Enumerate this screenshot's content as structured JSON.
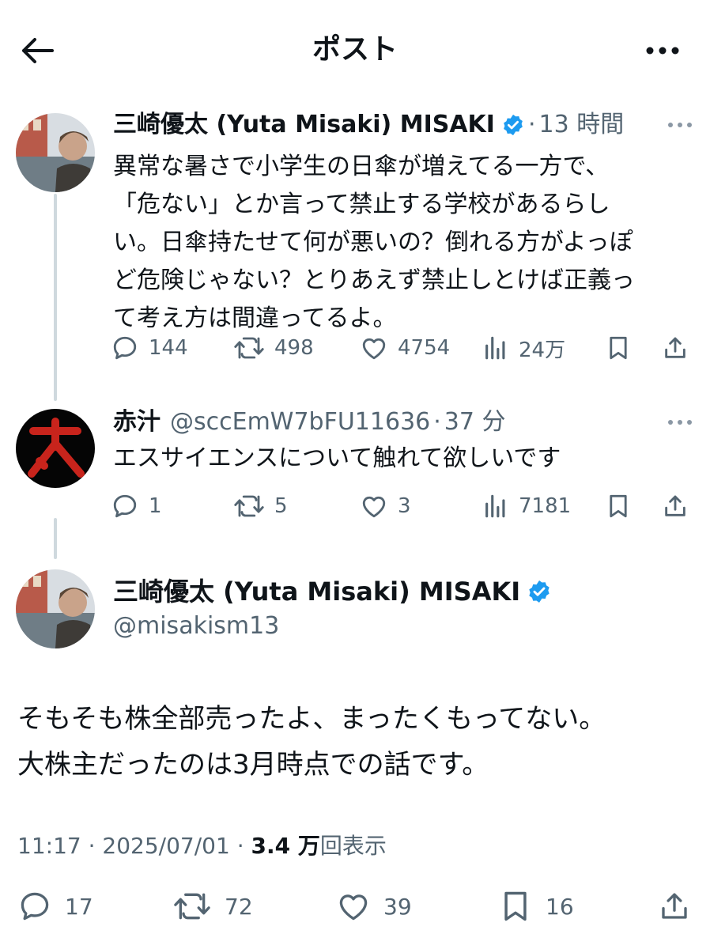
{
  "header": {
    "title": "ポスト"
  },
  "tweet1": {
    "display_name": "三崎優太 (Yuta Misaki) MISAKI",
    "time": "13 時間",
    "lines": [
      "異常な暑さで小学生の日傘が増えてる一方で、",
      "「危ない」とか言って禁止する学校があるらし",
      "い。日傘持たせて何が悪いの？倒れる方がよっぽ",
      "ど危険じゃない？とりあえず禁止しとけば正義っ",
      "て考え方は間違ってるよ。"
    ],
    "replies": "144",
    "reposts": "498",
    "likes": "4754",
    "views": "24万"
  },
  "tweet2": {
    "display_name": "赤汁",
    "handle": "@sccEmW7bFU11636",
    "time": "37 分",
    "text": "エスサイエンスについて触れて欲しいです",
    "replies": "1",
    "reposts": "5",
    "likes": "3",
    "views": "7181"
  },
  "main": {
    "display_name": "三崎優太 (Yuta Misaki) MISAKI",
    "handle": "@misakism13",
    "lines": [
      "そもそも株全部売ったよ、まったくもってない。",
      "大株主だったのは3月時点での話です。"
    ],
    "time": "11:17",
    "date": "2025/07/01",
    "views_count": "3.4 万",
    "views_label": "回表示",
    "replies": "17",
    "reposts": "72",
    "likes": "39",
    "bookmarks": "16"
  },
  "colors": {
    "verified": "#1d9bf0",
    "muted": "#536471",
    "thread_line": "#cfd9de"
  },
  "icons": [
    "back-arrow-icon",
    "more-icon",
    "verified-icon",
    "reply-icon",
    "repost-icon",
    "like-icon",
    "views-icon",
    "bookmark-icon",
    "share-icon"
  ]
}
